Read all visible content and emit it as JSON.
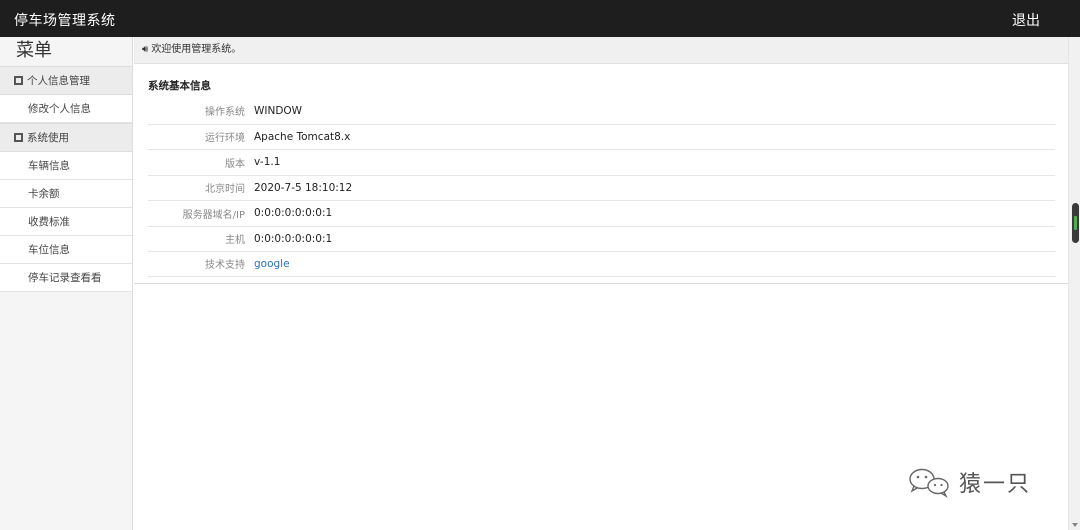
{
  "header": {
    "title": "停车场管理系统",
    "logout_label": "退出"
  },
  "sidebar": {
    "menu_title": "菜单",
    "groups": [
      {
        "label": "个人信息管理",
        "items": [
          {
            "label": "修改个人信息"
          }
        ]
      },
      {
        "label": "系统使用",
        "items": [
          {
            "label": "车辆信息"
          },
          {
            "label": "卡余额"
          },
          {
            "label": "收费标准"
          },
          {
            "label": "车位信息"
          },
          {
            "label": "停车记录查看看"
          }
        ]
      }
    ]
  },
  "notice": {
    "icon": "speaker-icon",
    "text": "欢迎使用管理系统。"
  },
  "panel": {
    "title": "系统基本信息",
    "rows": [
      {
        "label": "操作系统",
        "value": "WINDOW"
      },
      {
        "label": "运行环境",
        "value": "Apache Tomcat8.x"
      },
      {
        "label": "版本",
        "value": "v-1.1"
      },
      {
        "label": "北京时间",
        "value": "2020-7-5 18:10:12"
      },
      {
        "label": "服务器域名/IP",
        "value": "0:0:0:0:0:0:0:1"
      },
      {
        "label": "主机",
        "value": "0:0:0:0:0:0:0:1"
      },
      {
        "label": "技术支持",
        "value": "google"
      }
    ]
  },
  "watermark": {
    "text": "猿一只",
    "icon": "wechat-icon"
  },
  "colors": {
    "topbar": "#1e1e1e",
    "link": "#2a6fb8",
    "scroll_accent": "#4caf50"
  }
}
